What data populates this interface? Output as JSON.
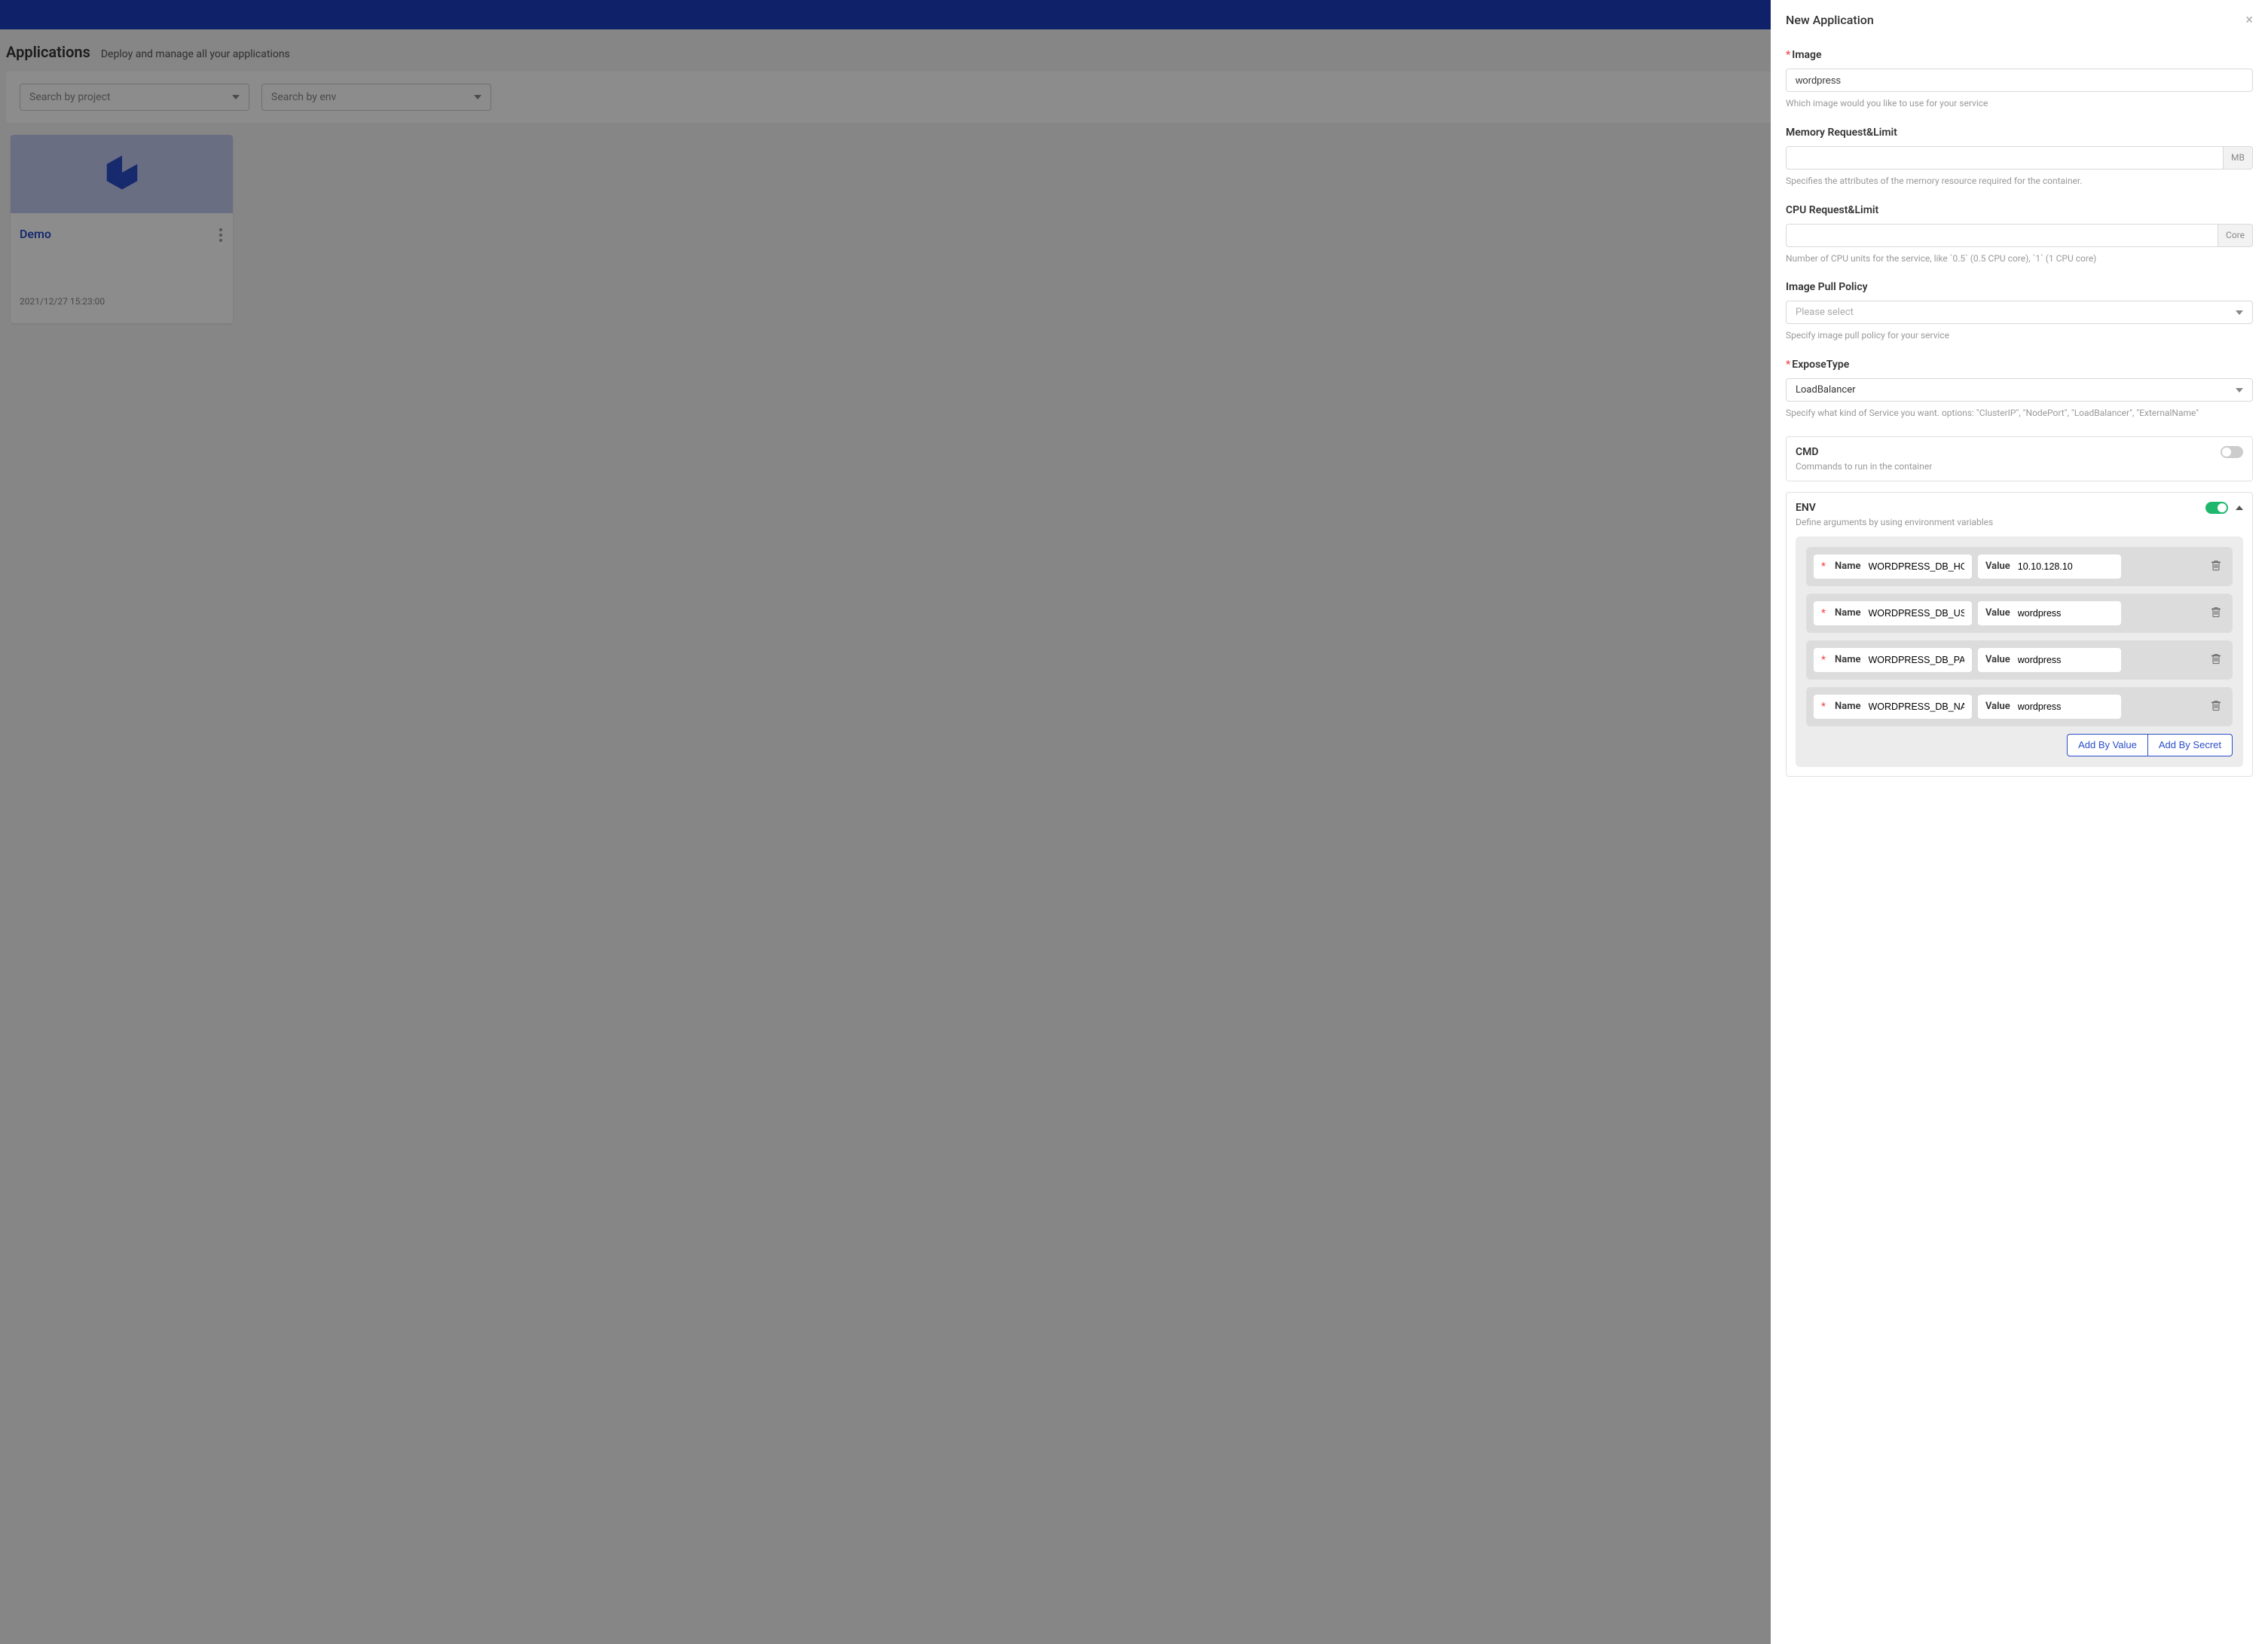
{
  "header": {
    "title": "Applications",
    "subtitle": "Deploy and manage all your applications"
  },
  "filters": {
    "project_placeholder": "Search by project",
    "env_placeholder": "Search by env"
  },
  "card": {
    "title": "Demo",
    "date": "2021/12/27 15:23:00"
  },
  "drawer": {
    "title": "New Application",
    "image": {
      "label": "Image",
      "value": "wordpress",
      "hint": "Which image would you like to use for your service"
    },
    "memory": {
      "label": "Memory Request&Limit",
      "suffix": "MB",
      "hint": "Specifies the attributes of the memory resource required for the container."
    },
    "cpu": {
      "label": "CPU Request&Limit",
      "suffix": "Core",
      "hint": "Number of CPU units for the service, like `0.5` (0.5 CPU core), `1` (1 CPU core)"
    },
    "pull_policy": {
      "label": "Image Pull Policy",
      "placeholder": "Please select",
      "hint": "Specify image pull policy for your service"
    },
    "expose": {
      "label": "ExposeType",
      "value": "LoadBalancer",
      "hint": "Specify what kind of Service you want. options: \"ClusterIP\", \"NodePort\", \"LoadBalancer\", \"ExternalName\""
    },
    "cmd": {
      "title": "CMD",
      "desc": "Commands to run in the container"
    },
    "env": {
      "title": "ENV",
      "desc": "Define arguments by using environment variables",
      "name_label": "Name",
      "value_label": "Value",
      "rows": [
        {
          "name": "WORDPRESS_DB_HOST",
          "value": "10.10.128.10"
        },
        {
          "name": "WORDPRESS_DB_USER",
          "value": "wordpress"
        },
        {
          "name": "WORDPRESS_DB_PASSWORD",
          "value": "wordpress"
        },
        {
          "name": "WORDPRESS_DB_NAME",
          "value": "wordpress"
        }
      ],
      "add_value": "Add By Value",
      "add_secret": "Add By Secret"
    }
  }
}
